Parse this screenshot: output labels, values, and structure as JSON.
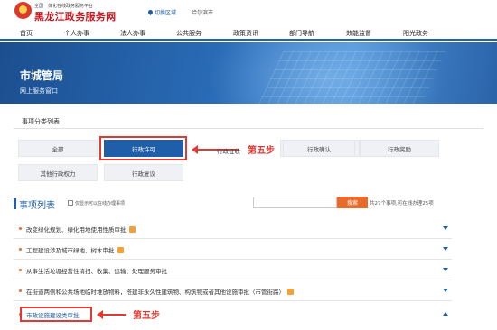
{
  "header": {
    "site_sub": "全国一体化在线政务服务平台",
    "site_name": "黑龙江政务服务网",
    "region_switch": "切换区域",
    "city": "哈尔滨市"
  },
  "nav": [
    "首页",
    "个人办事",
    "法人办事",
    "公共服务",
    "政策资讯",
    "部门导航",
    "效能监督",
    "阳光政务"
  ],
  "banner": {
    "title": "市城管局",
    "subtitle": "网上服务窗口"
  },
  "categories": {
    "heading": "事项分类列表",
    "items": [
      "全部",
      "行政许可",
      "行政征收",
      "行政确认",
      "行政奖励",
      "其他行政权力",
      "行政复议"
    ],
    "active": "行政许可"
  },
  "annotation": {
    "step_label": "第五步"
  },
  "list": {
    "title": "事项列表",
    "checkbox_label": "仅显示可以在线办理事项",
    "search_placeholder": "",
    "search_button": "搜索",
    "count_text": "共27个事项,可在线办理25项",
    "rows": [
      "改变绿化规划、绿化用地使用性质审批",
      "工程建设涉及城市绿地、树木审批",
      "从事生活垃圾经营性清扫、收集、运输、处理服务审批",
      "在街道两侧和公共场地临时堆放物料，搭建非永久性建筑物、构筑物或者其他设施审批（市管街路）",
      "市政设施建设类审批"
    ]
  },
  "colors": {
    "brand_red": "#c7161e",
    "nav_blue": "#1e63b4",
    "accent_orange": "#e96b2c",
    "annotation_red": "#e23a32"
  }
}
